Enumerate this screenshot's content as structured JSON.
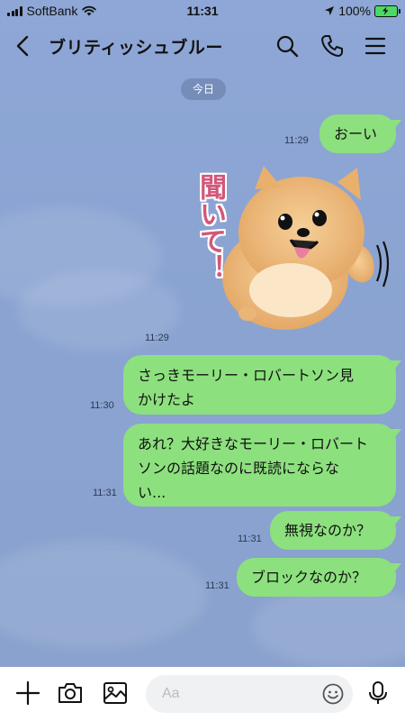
{
  "status_bar": {
    "carrier": "SoftBank",
    "time": "11:31",
    "battery": "100%"
  },
  "header": {
    "title": "ブリティッシュブルー"
  },
  "chat": {
    "date_label": "今日",
    "messages": [
      {
        "type": "text",
        "text": "おーい",
        "time": "11:29"
      },
      {
        "type": "sticker",
        "text": "聞いて！",
        "time": "11:29"
      },
      {
        "type": "text",
        "lines": [
          "さっきモーリー・ロバートソン見",
          "かけたよ"
        ],
        "time": "11:30"
      },
      {
        "type": "text",
        "lines": [
          "あれ？大好きなモーリー・ロバート",
          "ソンの話題なのに既読にならな",
          "い..."
        ],
        "time": "11:31"
      },
      {
        "type": "text",
        "text": "無視なのか？",
        "time": "11:31"
      },
      {
        "type": "text",
        "text": "ブロックなのか？",
        "time": "11:31"
      }
    ]
  },
  "input_bar": {
    "placeholder": "Aa"
  },
  "colors": {
    "background": "#8ea7d6",
    "bubble": "#8de07e",
    "sticker_text": "#d2577a"
  }
}
